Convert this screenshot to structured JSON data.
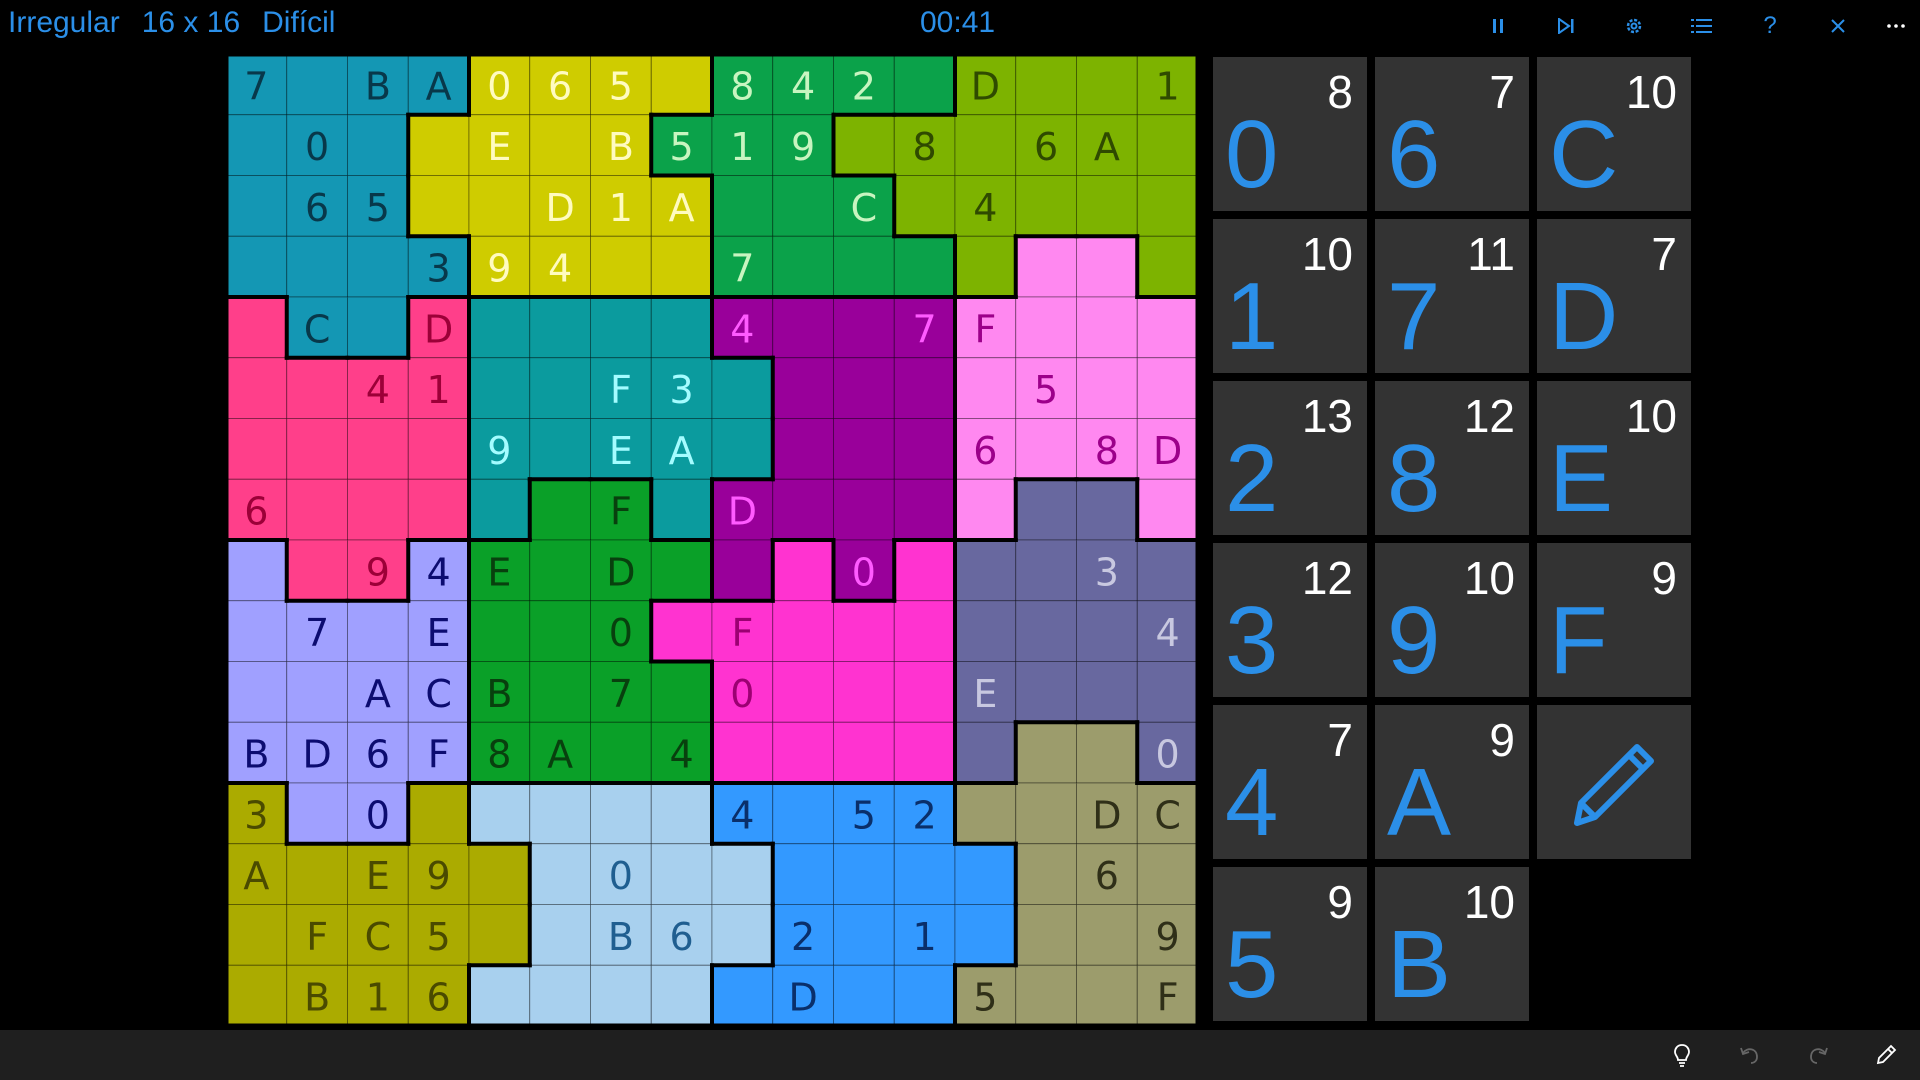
{
  "header": {
    "mode": "Irregular",
    "size": "16 x 16",
    "difficulty": "Difícil",
    "timer": "00:41",
    "icons": [
      "pause-icon",
      "skip-icon",
      "gear-icon",
      "list-icon",
      "help-icon",
      "close-icon",
      "more-icon"
    ],
    "accent": "#2b8fe8"
  },
  "board": {
    "rows": [
      "7.BA065.842.D..1",
      ".0..E.B519.8.6A.",
      ".65..D1A..C.4...",
      "...394..7.......",
      ".C.D....4..7F...",
      "..41..F3.....5..",
      "....9.EA....6.8D",
      "6.....F.D.......",
      "..94E.D...0...3.",
      ".7.E..0.F......4",
      "..ACB.7.0...E...",
      "BD6F8A.4.......0.",
      "3.0.....4.52..DC",
      "A.E9..0.......6.",
      ".FC5..B6.2.1...9",
      ".B16.....D..5..F"
    ],
    "regions": [
      "AAAABBBBCCCCDDDD",
      "AAABBBBCCCDDDDDD",
      "AAABBBBBCCCDDDDD",
      "AAAABBBBCCCCDEED",
      "FAAFGGGGHHHHEEEE",
      "FFFFGGGGGHHHEEEE",
      "FFFFGGGGGHHHEEEE",
      "FFFFGIIGHHHHEJJE",
      "KFFKIIIIHLHLJJJJ",
      "KKKKIIILLLLLJJJJ",
      "KKKKIIIILLLLJJJJ",
      "KKKKIIIILLLLJMMJ",
      "NKKNOOOOPPPPMMMM",
      "NNNNNOOOOPPPPMMM",
      "NNNNNOOOOPPPPMMM",
      "NNNNOOOOPPPPMMMM"
    ],
    "region_colors": {
      "A": {
        "fill": "#1497b4",
        "text": "#08384a"
      },
      "B": {
        "fill": "#cfcc00",
        "text": "#fffbc0"
      },
      "C": {
        "fill": "#0ba24a",
        "text": "#c8f5c0"
      },
      "D": {
        "fill": "#7db300",
        "text": "#2f4a00"
      },
      "E": {
        "fill": "#ff88f0",
        "text": "#9c008a"
      },
      "F": {
        "fill": "#ff3f8a",
        "text": "#9c0038"
      },
      "G": {
        "fill": "#0b9b9e",
        "text": "#a4fcff"
      },
      "H": {
        "fill": "#99009a",
        "text": "#ff5bff"
      },
      "I": {
        "fill": "#0aa028",
        "text": "#08400e"
      },
      "J": {
        "fill": "#68689f",
        "text": "#c8c8e0"
      },
      "K": {
        "fill": "#a0a0ff",
        "text": "#0c0c70"
      },
      "L": {
        "fill": "#ff33d0",
        "text": "#9c0072"
      },
      "M": {
        "fill": "#9c9c6c",
        "text": "#2f2f18"
      },
      "N": {
        "fill": "#abab00",
        "text": "#4a4a00"
      },
      "O": {
        "fill": "#a8d0ee",
        "text": "#1f5e90"
      },
      "P": {
        "fill": "#3399ff",
        "text": "#0a2f6a"
      }
    }
  },
  "number_pad": [
    {
      "digit": "0",
      "count": "8"
    },
    {
      "digit": "1",
      "count": "10"
    },
    {
      "digit": "2",
      "count": "13"
    },
    {
      "digit": "3",
      "count": "12"
    },
    {
      "digit": "4",
      "count": "7"
    },
    {
      "digit": "5",
      "count": "9"
    },
    {
      "digit": "6",
      "count": "7"
    },
    {
      "digit": "7",
      "count": "11"
    },
    {
      "digit": "8",
      "count": "12"
    },
    {
      "digit": "9",
      "count": "10"
    },
    {
      "digit": "A",
      "count": "9"
    },
    {
      "digit": "B",
      "count": "10"
    },
    {
      "digit": "C",
      "count": "10"
    },
    {
      "digit": "D",
      "count": "7"
    },
    {
      "digit": "E",
      "count": "10"
    },
    {
      "digit": "F",
      "count": "9"
    }
  ],
  "pencil_button": {
    "icon": "pencil-icon"
  },
  "footer": {
    "icons": [
      "lightbulb-icon",
      "undo-icon",
      "redo-icon",
      "pencil-icon"
    ]
  }
}
